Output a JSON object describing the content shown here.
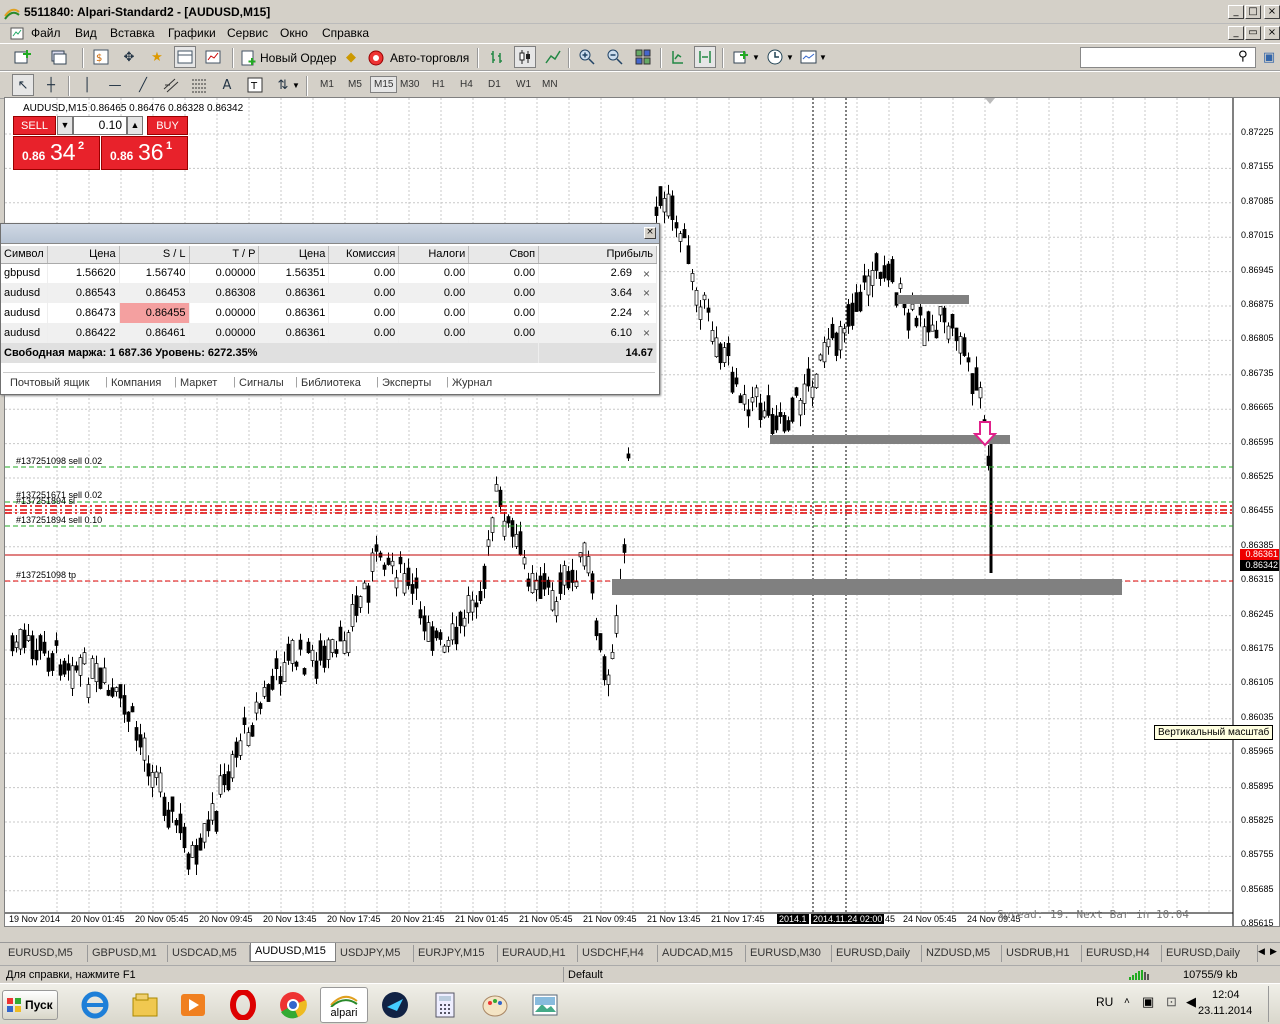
{
  "window": {
    "title": "5511840: Alpari-Standard2 - [AUDUSD,M15]"
  },
  "menu": [
    "Файл",
    "Вид",
    "Вставка",
    "Графики",
    "Сервис",
    "Окно",
    "Справка"
  ],
  "toolbar": {
    "new_order": "Новый Ордер",
    "auto_trading": "Авто-торговля"
  },
  "search": {
    "placeholder": ""
  },
  "timeframes": [
    "M1",
    "M5",
    "M15",
    "M30",
    "H1",
    "H4",
    "D1",
    "W1",
    "MN"
  ],
  "active_timeframe": "M15",
  "chart": {
    "header": "AUDUSD,M15  0.86465 0.86476 0.86328 0.86342",
    "sell_label": "SELL",
    "buy_label": "BUY",
    "lot": "0.10",
    "sell_price_small": "0.86",
    "sell_price_big": "34",
    "sell_price_sup": "2",
    "buy_price_small": "0.86",
    "buy_price_big": "36",
    "buy_price_sup": "1",
    "order_labels": [
      "#137251098 sell 0.02",
      "#137251671 sell 0.02",
      "#137251894 sl",
      "#137251894 sell 0.10",
      "#137251098 tp"
    ],
    "price_axis": [
      "0.87225",
      "0.87155",
      "0.87085",
      "0.87015",
      "0.86945",
      "0.86875",
      "0.86805",
      "0.86735",
      "0.86665",
      "0.86595",
      "0.86525",
      "0.86455",
      "0.86385",
      "0.86315",
      "0.86245",
      "0.86175",
      "0.86105",
      "0.86035",
      "0.85965",
      "0.85895",
      "0.85825",
      "0.85755",
      "0.85685",
      "0.85615"
    ],
    "bid_tag": "0.86361",
    "ask_tag": "0.86342",
    "time_axis": [
      "19 Nov 2014",
      "20 Nov 01:45",
      "20 Nov 05:45",
      "20 Nov 09:45",
      "20 Nov 13:45",
      "20 Nov 17:45",
      "20 Nov 21:45",
      "21 Nov 01:45",
      "21 Nov 05:45",
      "21 Nov 09:45",
      "21 Nov 13:45",
      "21 Nov 17:45",
      "2014.1",
      "2014.11.24 02:00",
      "45",
      "24 Nov 05:45",
      "24 Nov 09:45"
    ],
    "spread_text": "Spread: 19. Next Bar in 10:04",
    "tooltip": "Вертикальный масштаб"
  },
  "terminal": {
    "columns": [
      "Символ",
      "Цена",
      "S / L",
      "T / P",
      "Цена",
      "Комиссия",
      "Налоги",
      "Своп",
      "Прибыль"
    ],
    "rows": [
      [
        "gbpusd",
        "1.56620",
        "1.56740",
        "0.00000",
        "1.56351",
        "0.00",
        "0.00",
        "0.00",
        "2.69"
      ],
      [
        "audusd",
        "0.86543",
        "0.86453",
        "0.86308",
        "0.86361",
        "0.00",
        "0.00",
        "0.00",
        "3.64"
      ],
      [
        "audusd",
        "0.86473",
        "0.86455",
        "0.00000",
        "0.86361",
        "0.00",
        "0.00",
        "0.00",
        "2.24"
      ],
      [
        "audusd",
        "0.86422",
        "0.86461",
        "0.00000",
        "0.86361",
        "0.00",
        "0.00",
        "0.00",
        "6.10"
      ]
    ],
    "summary": "Свободная маржа: 1 687.36  Уровень: 6272.35%",
    "total": "14.67",
    "tabs": [
      "Почтовый ящик",
      "Компания",
      "Маркет",
      "Сигналы",
      "Библиотека",
      "Эксперты",
      "Журнал"
    ]
  },
  "symbol_tabs": [
    "EURUSD,M5",
    "GBPUSD,M1",
    "USDCAD,M5",
    "AUDUSD,M15",
    "USDJPY,M5",
    "EURJPY,M15",
    "EURAUD,H1",
    "USDCHF,H4",
    "AUDCAD,M15",
    "EURUSD,M30",
    "EURUSD,Daily",
    "NZDUSD,M5",
    "USDRUB,H1",
    "EURUSD,H4",
    "EURUSD,Daily"
  ],
  "status": {
    "help": "Для справки, нажмите F1",
    "profile": "Default",
    "traffic": "10755/9 kb"
  },
  "taskbar": {
    "start": "Пуск",
    "alpari": "alpari",
    "lang": "RU",
    "time": "12:04",
    "date": "23.11.2014"
  },
  "colors": {
    "sell": "#e8222b",
    "buy": "#e8222b",
    "stop_line": "#e00000",
    "order_line": "#22aa22"
  }
}
